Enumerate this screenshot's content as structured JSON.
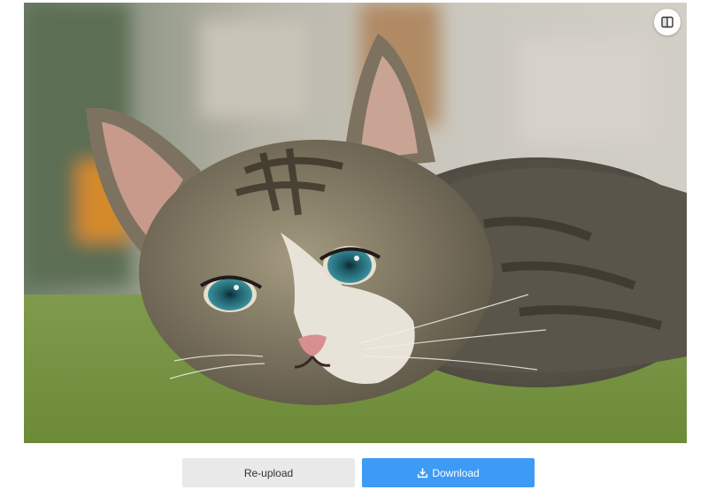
{
  "image": {
    "subject": "tabby kitten lying on green carpet"
  },
  "toolbar": {
    "compare_icon": "compare-icon"
  },
  "actions": {
    "reupload_label": "Re-upload",
    "download_label": "Download",
    "download_icon": "download-icon"
  },
  "colors": {
    "primary": "#3d9bf5",
    "secondary": "#e9e9e9"
  }
}
